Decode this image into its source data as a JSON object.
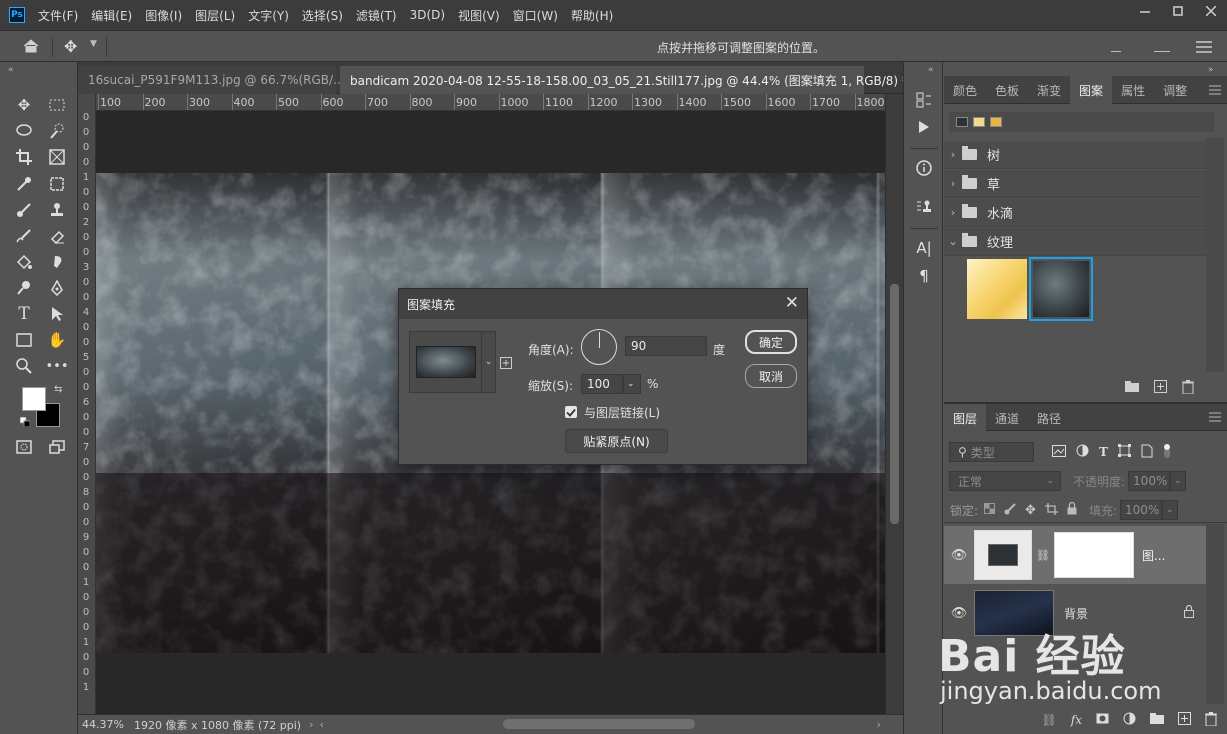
{
  "app": {
    "logo": "Ps",
    "menu": [
      "文件(F)",
      "编辑(E)",
      "图像(I)",
      "图层(L)",
      "文字(Y)",
      "选择(S)",
      "滤镜(T)",
      "3D(D)",
      "视图(V)",
      "窗口(W)",
      "帮助(H)"
    ],
    "window_controls": [
      "minimize-icon",
      "restore-icon",
      "close-icon"
    ]
  },
  "options_bar": {
    "hint": "点按并拖移可调整图案的位置。"
  },
  "tabs": [
    {
      "title": "16sucai_P591F9M113.jpg @ 66.7%(RGB/...",
      "close": "×",
      "active": false
    },
    {
      "title": "bandicam 2020-04-08 12-55-18-158.00_03_05_21.Still177.jpg @ 44.4% (图案填充 1, RGB/8) *",
      "close": "×",
      "active": true
    }
  ],
  "ruler_top": [
    "100",
    "200",
    "300",
    "400",
    "500",
    "600",
    "700",
    "800",
    "900",
    "1000",
    "1100",
    "1200",
    "1300",
    "1400",
    "1500",
    "1600",
    "1700",
    "1800"
  ],
  "ruler_left": [
    "0",
    "0",
    "0",
    "0",
    "1",
    "0",
    "0",
    "2",
    "0",
    "0",
    "3",
    "0",
    "0",
    "4",
    "0",
    "0",
    "5",
    "0",
    "0",
    "6",
    "0",
    "0",
    "7",
    "0",
    "0",
    "8",
    "0",
    "0",
    "9",
    "0",
    "0",
    "1",
    "0",
    "0",
    "0",
    "1",
    "0",
    "0",
    "1"
  ],
  "status": {
    "zoom": "44.37%",
    "doc_info": "1920 像素 x 1080 像素 (72 ppi)"
  },
  "pattern_panel": {
    "tabs": [
      "颜色",
      "色板",
      "渐变",
      "图案",
      "属性",
      "调整"
    ],
    "active_tab": "图案",
    "groups": [
      {
        "name": "树",
        "expanded": false
      },
      {
        "name": "草",
        "expanded": false
      },
      {
        "name": "水滴",
        "expanded": false
      },
      {
        "name": "纹理",
        "expanded": true
      }
    ]
  },
  "layers_panel": {
    "tabs": [
      "图层",
      "通道",
      "路径"
    ],
    "active_tab": "图层",
    "filter_placeholder": "类型",
    "blend_mode": "正常",
    "opacity_label": "不透明度:",
    "opacity_value": "100%",
    "lock_label": "锁定:",
    "fill_label": "填充:",
    "fill_value": "100%",
    "layers": [
      {
        "name": "图...",
        "selected": true
      },
      {
        "name": "背景",
        "selected": false,
        "locked": true
      }
    ]
  },
  "dialog": {
    "title": "图案填充",
    "angle_label": "角度(A):",
    "angle_value": "90",
    "angle_unit": "度",
    "scale_label": "缩放(S):",
    "scale_value": "100",
    "scale_unit": "%",
    "link_label": "与图层链接(L)",
    "link_checked": true,
    "snap_button": "贴紧原点(N)",
    "ok_button": "确定",
    "cancel_button": "取消"
  },
  "watermark": {
    "line1": "Bai 经验",
    "line2": "jingyan.baidu.com"
  },
  "colors": {
    "menubar": "#3c3c3c",
    "panel": "#535353",
    "selection": "#1473e6"
  }
}
